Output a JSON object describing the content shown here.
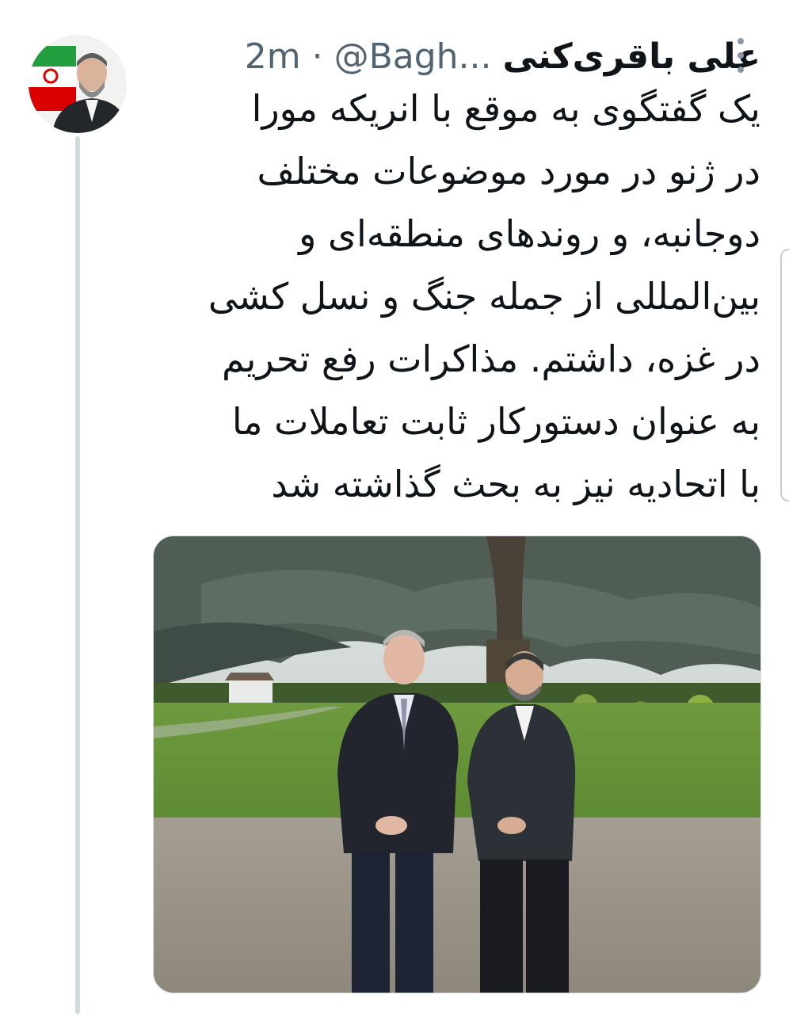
{
  "tweet": {
    "display_name": "علی باقری‌کنی",
    "handle": "@Bagh...",
    "separator": "·",
    "time": "2m",
    "text_lines": [
      "یک گفتگوی به موقع با انریکه مورا",
      "در ژنو در مورد موضوعات مختلف",
      "دوجانبه، و روندهای منطقه‌ای و",
      "بین‌المللی از جمله جنگ و نسل کشی",
      "در غزه، داشتم. مذاکرات رفع تحریم",
      "به عنوان دستورکار ثابت تعاملات ما",
      "با اتحادیه نیز به بحث گذاشته شد"
    ]
  },
  "icons": {
    "more": "more-vertical-icon",
    "avatar": "avatar-photo"
  },
  "colors": {
    "text": "#0f1419",
    "secondary": "#536471",
    "thread_line": "#cfd9de"
  }
}
